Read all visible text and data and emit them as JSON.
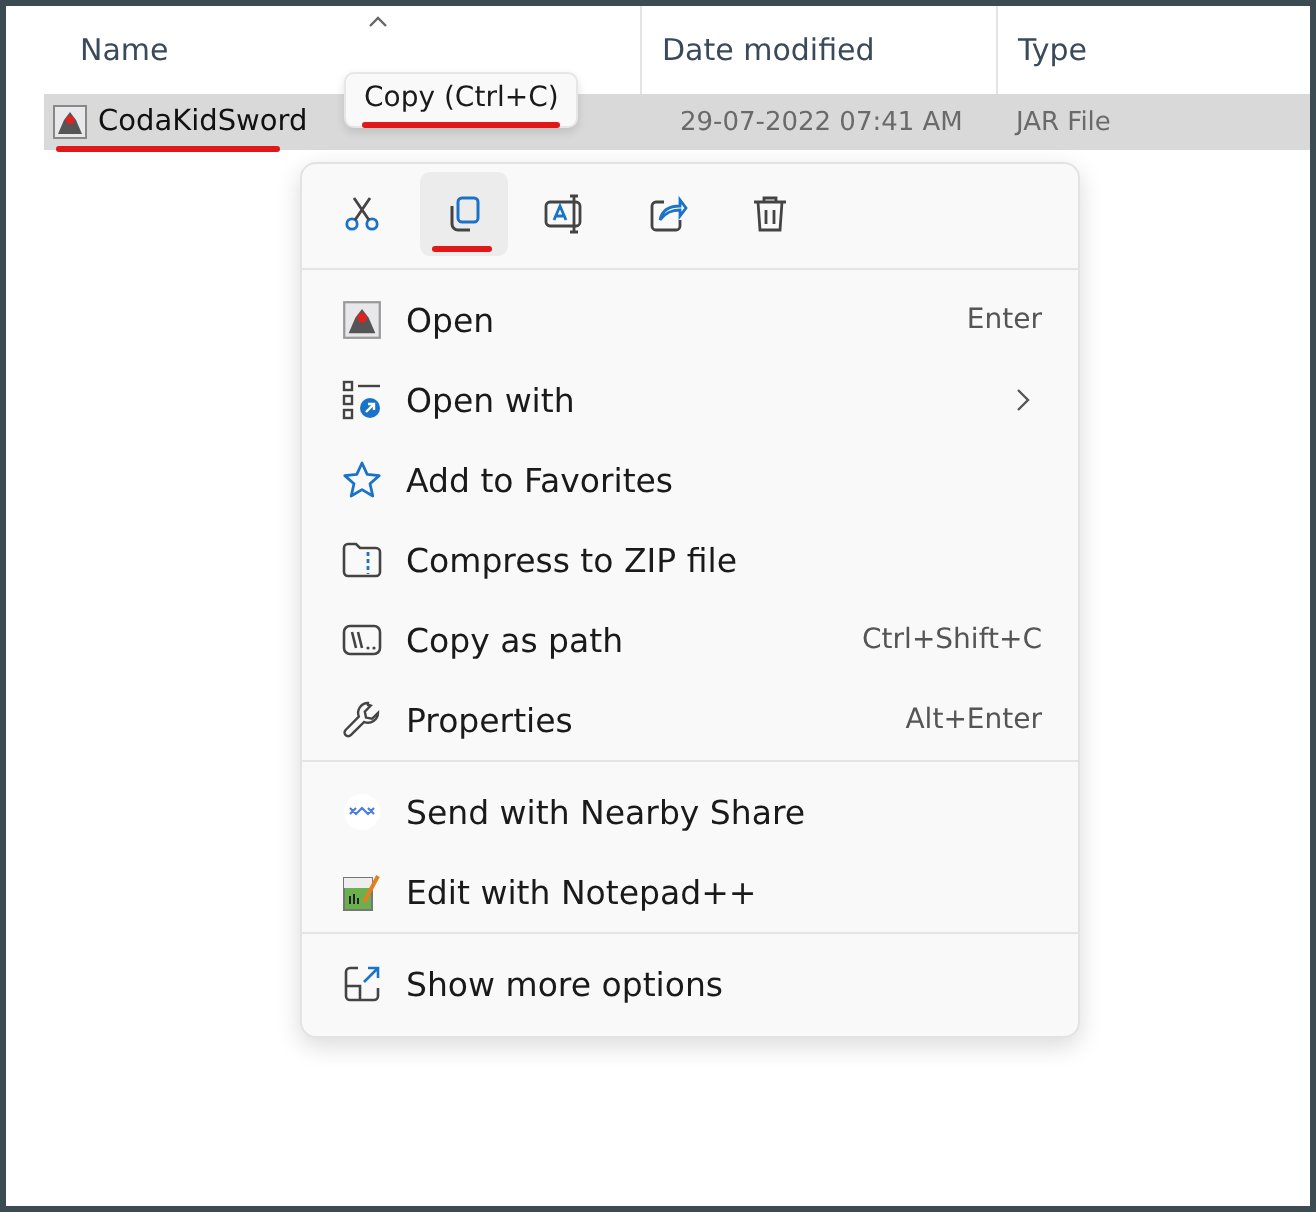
{
  "columns": [
    {
      "label": "Name",
      "sorted": true
    },
    {
      "label": "Date modified",
      "sorted": false
    },
    {
      "label": "Type",
      "sorted": false
    }
  ],
  "file": {
    "name": "CodaKidSword",
    "date_modified": "29-07-2022 07:41 AM",
    "type": "JAR File",
    "selected": true,
    "underlined": true
  },
  "tooltip": {
    "text": "Copy (Ctrl+C)",
    "underlined": true
  },
  "toolbar": [
    {
      "kind": "cut",
      "selected": false,
      "underlined": false
    },
    {
      "kind": "copy",
      "selected": true,
      "underlined": true
    },
    {
      "kind": "rename",
      "selected": false,
      "underlined": false
    },
    {
      "kind": "share",
      "selected": false,
      "underlined": false
    },
    {
      "kind": "delete",
      "selected": false,
      "underlined": false
    }
  ],
  "menu_groups": [
    [
      {
        "kind": "app",
        "label": "Open",
        "shortcut": "Enter"
      },
      {
        "kind": "openwith",
        "label": "Open with",
        "submenu": true
      },
      {
        "kind": "star",
        "label": "Add to Favorites"
      },
      {
        "kind": "zip",
        "label": "Compress to ZIP file"
      },
      {
        "kind": "path",
        "label": "Copy as path",
        "shortcut": "Ctrl+Shift+C"
      },
      {
        "kind": "wrench",
        "label": "Properties",
        "shortcut": "Alt+Enter"
      }
    ],
    [
      {
        "kind": "nearby",
        "label": "Send with Nearby Share"
      },
      {
        "kind": "notepad",
        "label": "Edit with Notepad++"
      }
    ],
    [
      {
        "kind": "more",
        "label": "Show more options"
      }
    ]
  ]
}
